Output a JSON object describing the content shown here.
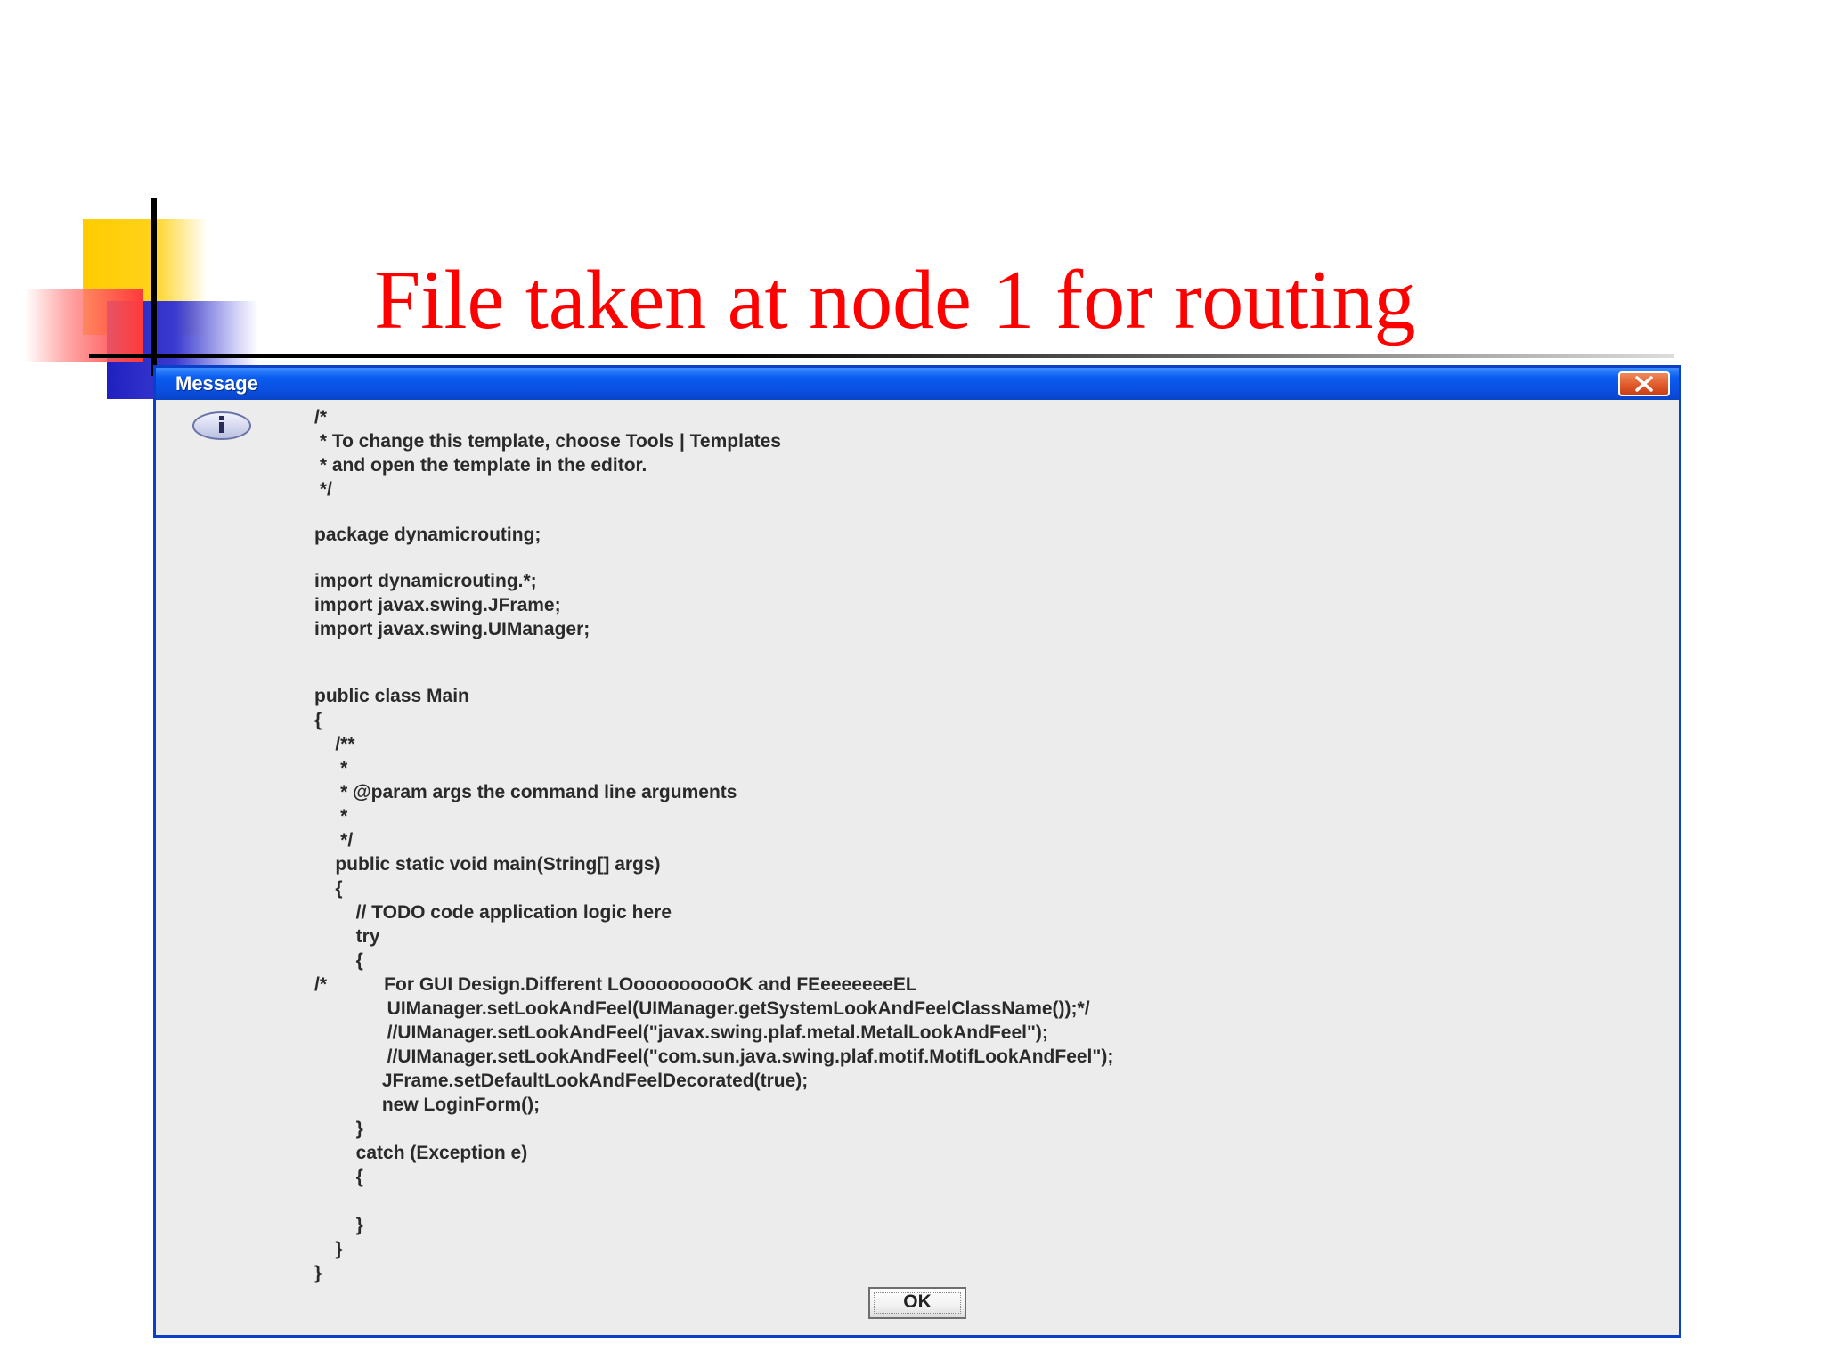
{
  "slide": {
    "title": "File taken at node 1 for routing"
  },
  "dialog": {
    "title": "Message",
    "ok_label": "OK",
    "lines": [
      "/*",
      " * To change this template, choose Tools | Templates",
      " * and open the template in the editor.",
      " */",
      "package dynamicrouting;",
      "import dynamicrouting.*;",
      "import javax.swing.JFrame;",
      "import javax.swing.UIManager;",
      "public class Main",
      "{",
      "    /**",
      "     *",
      "     * @param args the command line arguments",
      "     *",
      "     */",
      "    public static void main(String[] args)",
      "    {",
      "        // TODO code application logic here",
      "        try",
      "        {",
      "/*           For GUI Design.Different LOooooooooOK and FEeeeeeeeEL",
      "              UIManager.setLookAndFeel(UIManager.getSystemLookAndFeelClassName());*/",
      "              //UIManager.setLookAndFeel(\"javax.swing.plaf.metal.MetalLookAndFeel\");",
      "              //UIManager.setLookAndFeel(\"com.sun.java.swing.plaf.motif.MotifLookAndFeel\");",
      "             JFrame.setDefaultLookAndFeelDecorated(true);",
      "             new LoginForm();",
      "        }",
      "        catch (Exception e)",
      "        {",
      "        }",
      "    }",
      "}"
    ]
  }
}
